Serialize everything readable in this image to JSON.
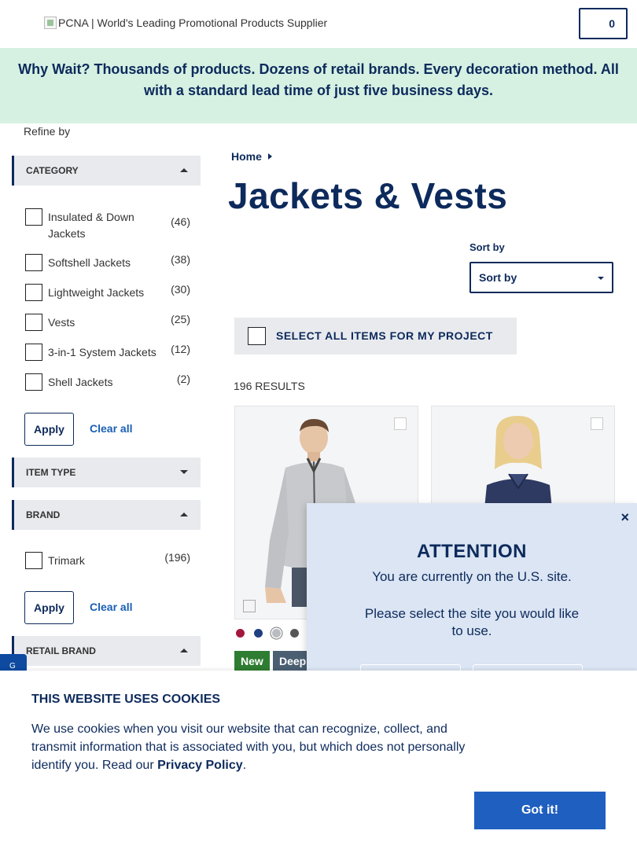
{
  "header": {
    "logo_alt": "PCNA | World's Leading Promotional Products Supplier",
    "cart_count": "0"
  },
  "banner": {
    "text": "Why Wait? Thousands of products. Dozens of retail brands. Every decoration method. All with a standard lead time of just five business days."
  },
  "sidebar": {
    "refine_label": "Refine by",
    "category": {
      "title": "CATEGORY",
      "items": [
        {
          "label": "Insulated & Down Jackets",
          "count": "(46)"
        },
        {
          "label": "Softshell Jackets",
          "count": "(38)"
        },
        {
          "label": "Lightweight Jackets",
          "count": "(30)"
        },
        {
          "label": "Vests",
          "count": "(25)"
        },
        {
          "label": "3-in-1 System Jackets",
          "count": "(12)"
        },
        {
          "label": "Shell Jackets",
          "count": "(2)"
        }
      ],
      "apply": "Apply",
      "clear": "Clear all"
    },
    "item_type": {
      "title": "ITEM TYPE"
    },
    "brand": {
      "title": "BRAND",
      "items": [
        {
          "label": "Trimark",
          "count": "(196)"
        }
      ],
      "apply": "Apply",
      "clear": "Clear all"
    },
    "retail_brand": {
      "title": "RETAIL BRAND"
    },
    "side_tab": "G"
  },
  "main": {
    "breadcrumb": "Home",
    "title": "Jackets & Vests",
    "sort_label": "Sort by",
    "sort_value": "Sort by",
    "select_all": "SELECT ALL ITEMS FOR MY PROJECT",
    "results": "196 RESULTS",
    "card1": {
      "swatches": [
        "#a3173f",
        "#1f3f80",
        "#b9bcc0",
        "#555555"
      ],
      "badges": [
        {
          "label": "New",
          "color": "#2e7d32"
        },
        {
          "label": "Deep",
          "color": "#4b5f73"
        }
      ]
    }
  },
  "modal": {
    "close": "×",
    "title": "ATTENTION",
    "line1": "You are currently on the U.S. site.",
    "line2": "Please select the site you would like to use."
  },
  "cookie": {
    "title": "THIS WEBSITE USES COOKIES",
    "text": "We use cookies when you visit our website that can recognize, collect, and transmit information that is associated with you, but which does not personally identify you. Read our",
    "link": "Privacy Policy",
    "period": ".",
    "button": "Got it!"
  },
  "colors": {
    "navy": "#0d2a5c",
    "banner_bg": "#d6f1e2",
    "facet_bg": "#e8eaee",
    "link": "#1a5fb4",
    "cta": "#1f5fbf",
    "modal_bg": "#dbe5f3"
  }
}
